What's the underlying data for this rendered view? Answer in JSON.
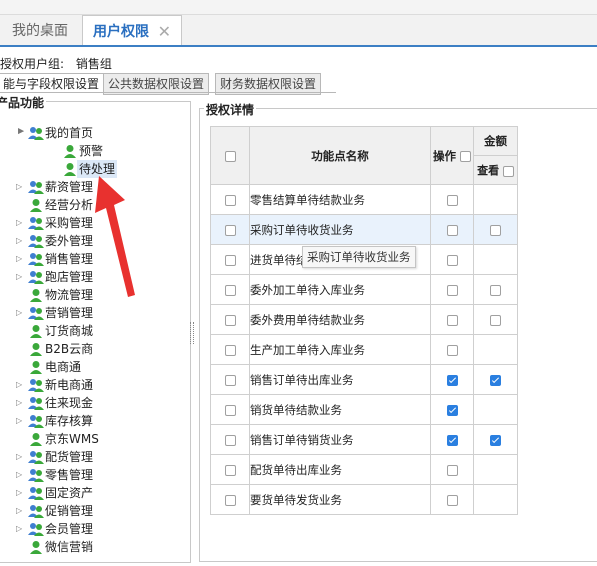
{
  "tabs": {
    "desktop": "我的桌面",
    "active": "用户权限",
    "close_glyph": "✕"
  },
  "group_line": {
    "label": "授权用户组:",
    "value": "销售组"
  },
  "subtabs": [
    "能与字段权限设置",
    "公共数据权限设置",
    "财务数据权限设置"
  ],
  "left_panel": {
    "title": "产品功能",
    "tree": [
      {
        "label": "我的首页",
        "toggle": "▲",
        "kind": "group"
      },
      {
        "label": "预警",
        "toggle": "",
        "kind": "user"
      },
      {
        "label": "待处理",
        "toggle": "",
        "kind": "user",
        "selected": true
      },
      {
        "label": "薪资管理",
        "toggle": "▷",
        "kind": "group"
      },
      {
        "label": "经营分析",
        "toggle": "",
        "kind": "user"
      },
      {
        "label": "采购管理",
        "toggle": "▷",
        "kind": "group"
      },
      {
        "label": "委外管理",
        "toggle": "▷",
        "kind": "group"
      },
      {
        "label": "销售管理",
        "toggle": "▷",
        "kind": "group"
      },
      {
        "label": "跑店管理",
        "toggle": "▷",
        "kind": "group"
      },
      {
        "label": "物流管理",
        "toggle": "",
        "kind": "user"
      },
      {
        "label": "营销管理",
        "toggle": "▷",
        "kind": "group"
      },
      {
        "label": "订货商城",
        "toggle": "",
        "kind": "user"
      },
      {
        "label": "B2B云商",
        "toggle": "",
        "kind": "user"
      },
      {
        "label": "电商通",
        "toggle": "",
        "kind": "user"
      },
      {
        "label": "新电商通",
        "toggle": "▷",
        "kind": "group"
      },
      {
        "label": "往来现金",
        "toggle": "▷",
        "kind": "group"
      },
      {
        "label": "库存核算",
        "toggle": "▷",
        "kind": "group"
      },
      {
        "label": "京东WMS",
        "toggle": "",
        "kind": "user"
      },
      {
        "label": "配货管理",
        "toggle": "▷",
        "kind": "group"
      },
      {
        "label": "零售管理",
        "toggle": "▷",
        "kind": "group"
      },
      {
        "label": "固定资产",
        "toggle": "▷",
        "kind": "group"
      },
      {
        "label": "促销管理",
        "toggle": "▷",
        "kind": "group"
      },
      {
        "label": "会员管理",
        "toggle": "▷",
        "kind": "group"
      },
      {
        "label": "微信营销",
        "toggle": "",
        "kind": "user"
      }
    ]
  },
  "right_panel": {
    "title": "授权详情",
    "columns": {
      "name": "功能点名称",
      "operate": "操作",
      "amount": "金额",
      "view": "查看"
    },
    "rows": [
      {
        "name": "零售结算单待结款业务",
        "op": false,
        "view": null
      },
      {
        "name": "采购订单待收货业务",
        "op": false,
        "view": false,
        "highlight": true
      },
      {
        "name": "进货单待结",
        "op": false,
        "view": null
      },
      {
        "name": "委外加工单待入库业务",
        "op": false,
        "view": false
      },
      {
        "name": "委外费用单待结款业务",
        "op": false,
        "view": false
      },
      {
        "name": "生产加工单待入库业务",
        "op": false,
        "view": null
      },
      {
        "name": "销售订单待出库业务",
        "op": true,
        "view": true
      },
      {
        "name": "销货单待结款业务",
        "op": true,
        "view": null
      },
      {
        "name": "销售订单待销货业务",
        "op": true,
        "view": true
      },
      {
        "name": "配货单待出库业务",
        "op": false,
        "view": null
      },
      {
        "name": "要货单待发货业务",
        "op": false,
        "view": null
      }
    ],
    "tooltip": "采购订单待收货业务"
  },
  "colors": {
    "accent": "#2a6fc0",
    "checked": "#2a7fe0",
    "arrow": "#e8312f",
    "icon_green": "#3aa83a",
    "icon_blue": "#3f7fd0"
  }
}
